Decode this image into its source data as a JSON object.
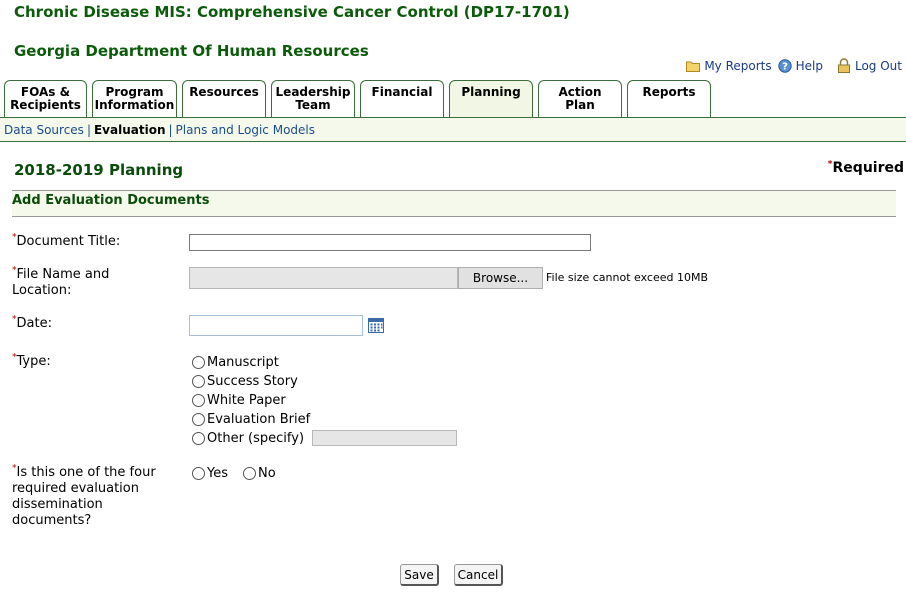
{
  "app_title": "Chronic Disease MIS: Comprehensive Cancer Control (DP17-1701)",
  "org_name": "Georgia Department Of Human Resources",
  "top_links": {
    "my_reports": "My Reports",
    "help": "Help",
    "log_out": "Log Out"
  },
  "tabs": [
    {
      "line1": "FOAs &",
      "line2": "Recipients"
    },
    {
      "line1": "Program",
      "line2": "Information"
    },
    {
      "line1": "Resources",
      "line2": ""
    },
    {
      "line1": "Leadership",
      "line2": "Team"
    },
    {
      "line1": "Financial",
      "line2": ""
    },
    {
      "line1": "Planning",
      "line2": ""
    },
    {
      "line1": "Action",
      "line2": "Plan"
    },
    {
      "line1": "Reports",
      "line2": ""
    }
  ],
  "active_tab": "Planning",
  "subnav": {
    "data_sources": "Data Sources",
    "evaluation": "Evaluation",
    "plans_logic": "Plans and Logic Models",
    "sep": "|"
  },
  "page_title": "2018-2019 Planning",
  "required_note": "Required",
  "required_marker": "*",
  "section_title": "Add Evaluation Documents",
  "form": {
    "doc_title_label": "Document Title:",
    "doc_title_value": "",
    "file_label_1": "File Name and",
    "file_label_2": "Location:",
    "browse_label": "Browse...",
    "file_hint": "File size cannot exceed 10MB",
    "date_label": "Date:",
    "date_value": "",
    "type_label": "Type:",
    "type_options": [
      "Manuscript",
      "Success Story",
      "White Paper",
      "Evaluation Brief",
      "Other (specify)"
    ],
    "question_line1": "Is this one of the four",
    "question_line2": "required evaluation",
    "question_line3": "dissemination",
    "question_line4": "documents?",
    "yes_label": "Yes",
    "no_label": "No"
  },
  "buttons": {
    "save": "Save",
    "cancel": "Cancel"
  },
  "colors": {
    "header_green": "#0b5b0b",
    "link_blue": "#1a4d8a",
    "required_red": "#c00000",
    "tab_border": "#3b6e3b",
    "active_tab_bg": "#f1f7e4"
  }
}
